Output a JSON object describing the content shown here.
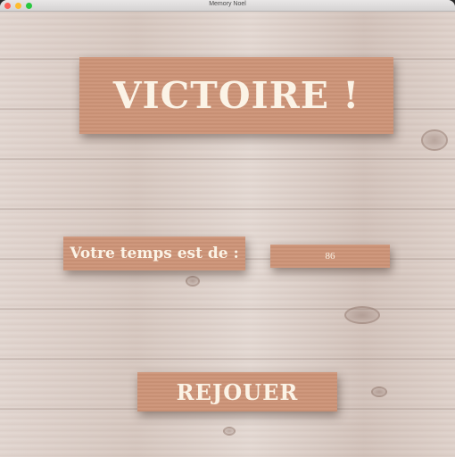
{
  "window": {
    "title": "Memory Noel"
  },
  "screen": {
    "victory_text": "VICTOIRE !",
    "time_label": "Votre temps est de :",
    "time_value": "86",
    "replay_label": "REJOUER"
  },
  "colors": {
    "plank": "#cd9478",
    "plank_text": "#fbf3e6",
    "background_wood": "#dccfc8"
  }
}
